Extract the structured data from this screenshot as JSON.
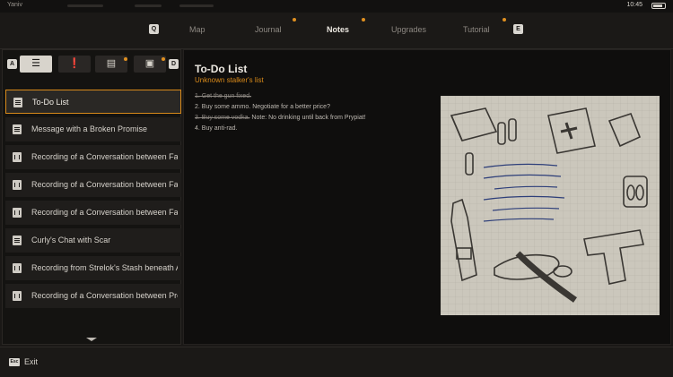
{
  "system": {
    "user": "Yaniv",
    "time": "10:45"
  },
  "nav": {
    "prev_key": "Q",
    "next_key": "E",
    "tabs": [
      {
        "label": "Map"
      },
      {
        "label": "Journal"
      },
      {
        "label": "Notes"
      },
      {
        "label": "Upgrades"
      },
      {
        "label": "Tutorial"
      }
    ],
    "active_tab": "Notes"
  },
  "filters": {
    "prev_key": "A",
    "next_key": "D",
    "buttons": [
      "list-icon",
      "exclamation-icon",
      "note-icon",
      "photo-note-icon"
    ],
    "selected": "list-icon"
  },
  "notes_list": [
    {
      "label": "To-Do List",
      "icon": "note-icon"
    },
    {
      "label": "Message with a Broken Promise",
      "icon": "note-icon"
    },
    {
      "label": "Recording of a Conversation between Faust...",
      "icon": "recording-icon"
    },
    {
      "label": "Recording of a Conversation between Faust...",
      "icon": "recording-icon"
    },
    {
      "label": "Recording of a Conversation between Faust...",
      "icon": "recording-icon"
    },
    {
      "label": "Curly's Chat with Scar",
      "icon": "note-icon"
    },
    {
      "label": "Recording from Strelok's Stash beneath Ah...",
      "icon": "recording-icon"
    },
    {
      "label": "Recording of a Conversation between Profe...",
      "icon": "recording-icon"
    }
  ],
  "note": {
    "title": "To-Do List",
    "subtitle": "Unknown stalker's list",
    "lines": [
      {
        "struck": "1. Get the gun fixed.",
        "rest": ""
      },
      {
        "struck": "",
        "rest": "2. Buy some ammo. Negotiate for a better price?"
      },
      {
        "struck": "3. Buy some vodka.",
        "rest": " Note: No drinking until back from Prypiat!"
      },
      {
        "struck": "",
        "rest": "4. Buy anti-rad."
      }
    ]
  },
  "footer": {
    "key": "Esc",
    "label": "Exit"
  },
  "colors": {
    "accent": "#d98a1a",
    "panel": "#141311",
    "paper": "#c3bfb4"
  }
}
